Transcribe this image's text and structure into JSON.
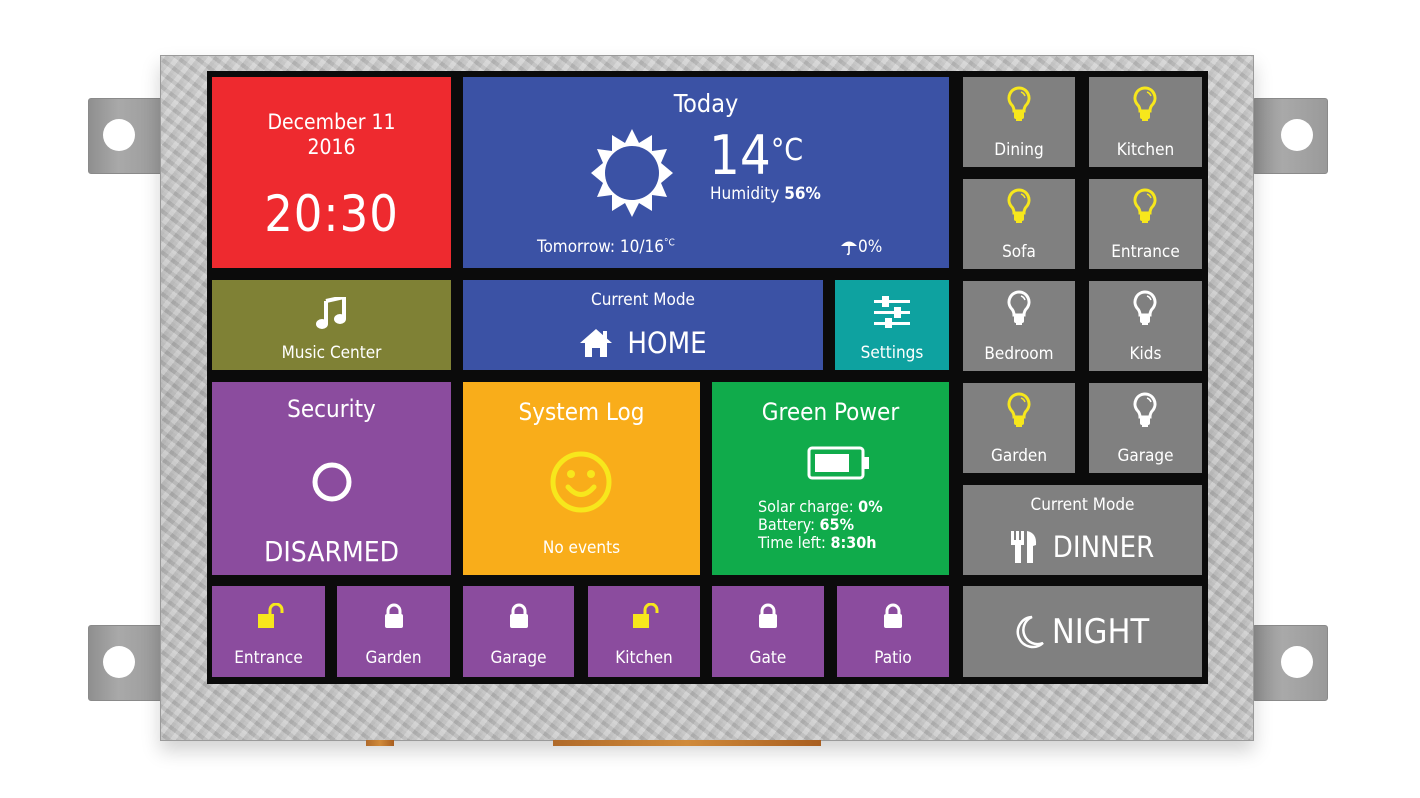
{
  "clock": {
    "date": "December 11",
    "year": "2016",
    "time": "20:30"
  },
  "weather": {
    "title": "Today",
    "icon": "sun-icon",
    "temperature": "14",
    "unit": "°C",
    "humidity_label": "Humidity",
    "humidity_value": "56%",
    "tomorrow_label": "Tomorrow: 10/16",
    "tomorrow_unit": "°C",
    "rain_icon": "umbrella-icon",
    "rain_chance": "0%"
  },
  "music": {
    "label": "Music Center",
    "icon": "music-note-icon"
  },
  "mode_home": {
    "caption": "Current Mode",
    "value": "HOME",
    "icon": "home-icon"
  },
  "settings": {
    "label": "Settings",
    "icon": "sliders-icon"
  },
  "security": {
    "title": "Security",
    "status": "DISARMED",
    "icon": "ring-icon"
  },
  "system_log": {
    "title": "System Log",
    "status": "No events",
    "icon": "smiley-icon"
  },
  "green_power": {
    "title": "Green Power",
    "icon": "battery-icon",
    "solar_label": "Solar charge:",
    "solar_value": "0%",
    "battery_label": "Battery:",
    "battery_value": "65%",
    "time_label": "Time left:",
    "time_value": "8:30h"
  },
  "locks": [
    {
      "label": "Entrance",
      "state": "unlocked"
    },
    {
      "label": "Garden",
      "state": "locked"
    },
    {
      "label": "Garage",
      "state": "locked"
    },
    {
      "label": "Kitchen",
      "state": "unlocked"
    },
    {
      "label": "Gate",
      "state": "locked"
    },
    {
      "label": "Patio",
      "state": "locked"
    }
  ],
  "lights": [
    {
      "label": "Dining",
      "on": true
    },
    {
      "label": "Kitchen",
      "on": true
    },
    {
      "label": "Sofa",
      "on": true
    },
    {
      "label": "Entrance",
      "on": true
    },
    {
      "label": "Bedroom",
      "on": false
    },
    {
      "label": "Kids",
      "on": false
    },
    {
      "label": "Garden",
      "on": true
    },
    {
      "label": "Garage",
      "on": false
    }
  ],
  "mode_dinner": {
    "caption": "Current Mode",
    "value": "DINNER",
    "icon": "cutlery-icon"
  },
  "mode_night": {
    "value": "NIGHT",
    "icon": "moon-icon"
  },
  "colors": {
    "clock": "#ee2a2f",
    "weather": "#3b52a5",
    "music": "#7f8135",
    "settings": "#0ea2a0",
    "security": "#8b4c9e",
    "system_log": "#f9ad1a",
    "green_power": "#10ab4b",
    "light_tiles": "#808080",
    "light_on": "#f7e71c",
    "light_off": "#ffffff"
  }
}
